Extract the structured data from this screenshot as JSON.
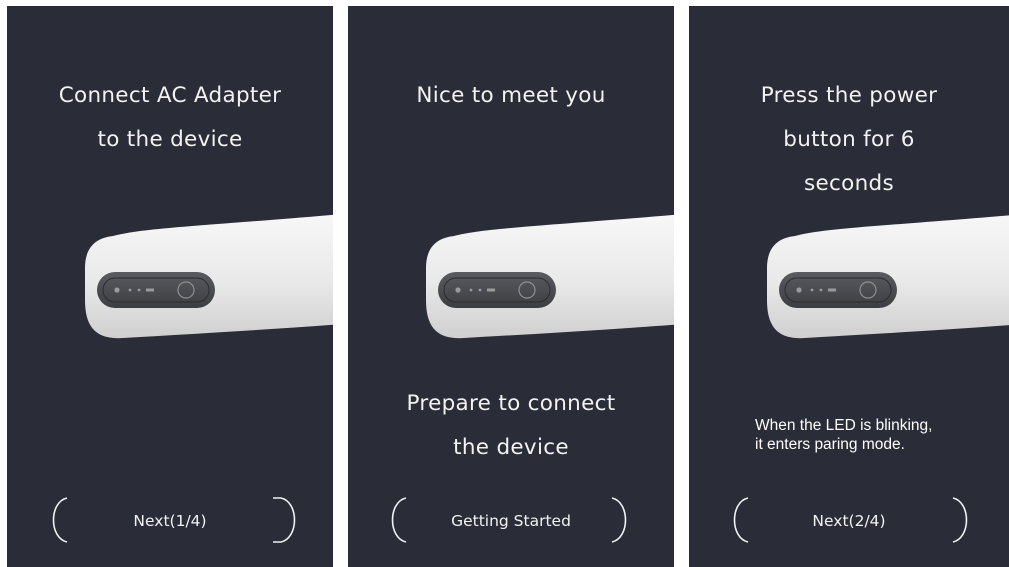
{
  "colors": {
    "panel_background": "#2a2d38",
    "text": "#f2f2f2",
    "device_body": "#eeeeee",
    "device_port_panel": "#4a4b4f"
  },
  "screens": [
    {
      "title_lines": [
        "Connect AC Adapter",
        "to the device"
      ],
      "nav": {
        "prev_icon": "left-bracket-icon",
        "label": "Next(1/4)",
        "next_icon": "right-bracket-icon"
      }
    },
    {
      "title_lines": [
        "Nice to meet you"
      ],
      "subtitle_lines": [
        "Prepare to connect",
        "the device"
      ],
      "nav": {
        "prev_icon": "left-bracket-icon",
        "label": "Getting Started",
        "next_icon": "right-bracket-icon"
      }
    },
    {
      "title_lines": [
        "Press the power",
        "button for 6",
        "seconds"
      ],
      "note_lines": [
        "When the LED is blinking,",
        "it enters paring mode."
      ],
      "nav": {
        "prev_icon": "left-bracket-icon",
        "label": "Next(2/4)",
        "next_icon": "right-bracket-icon"
      }
    }
  ]
}
